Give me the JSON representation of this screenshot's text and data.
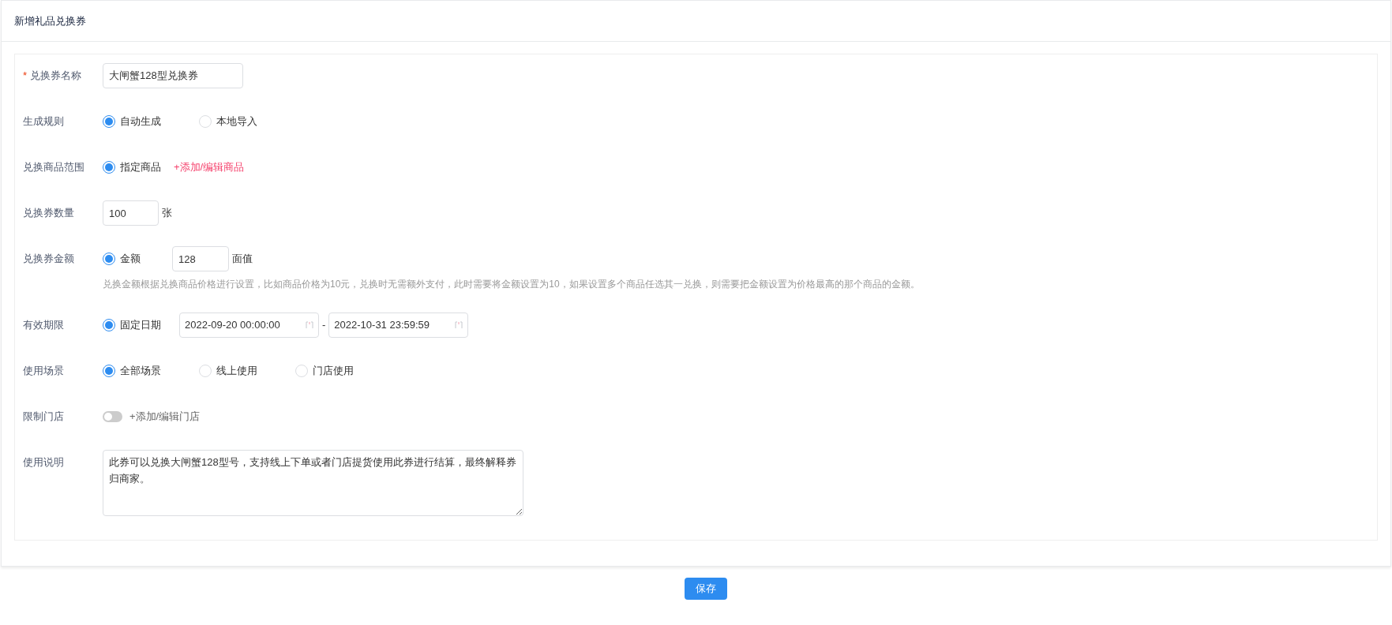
{
  "page_title": "新增礼品兑换券",
  "form": {
    "name": {
      "label": "兑换券名称",
      "required_mark": "*",
      "value": "大闸蟹128型兑换券"
    },
    "generation_rule": {
      "label": "生成规则",
      "options": [
        {
          "label": "自动生成",
          "selected": true
        },
        {
          "label": "本地导入",
          "selected": false
        }
      ]
    },
    "product_scope": {
      "label": "兑换商品范围",
      "options": [
        {
          "label": "指定商品",
          "selected": true
        }
      ],
      "link": "+添加/编辑商品"
    },
    "quantity": {
      "label": "兑换券数量",
      "value": "100",
      "unit": "张"
    },
    "amount": {
      "label": "兑换券金额",
      "options": [
        {
          "label": "金额",
          "selected": true
        }
      ],
      "value": "128",
      "unit": "面值",
      "hint": "兑换金额根据兑换商品价格进行设置，比如商品价格为10元，兑换时无需额外支付，此时需要将金额设置为10，如果设置多个商品任选其一兑换，则需要把金额设置为价格最高的那个商品的金额。"
    },
    "validity": {
      "label": "有效期限",
      "options": [
        {
          "label": "固定日期",
          "selected": true
        }
      ],
      "start": "2022-09-20 00:00:00",
      "separator": "-",
      "end": "2022-10-31 23:59:59"
    },
    "scene": {
      "label": "使用场景",
      "options": [
        {
          "label": "全部场景",
          "selected": true
        },
        {
          "label": "线上使用",
          "selected": false
        },
        {
          "label": "门店使用",
          "selected": false
        }
      ]
    },
    "restrict_store": {
      "label": "限制门店",
      "on": false,
      "link": "+添加/编辑门店"
    },
    "description": {
      "label": "使用说明",
      "value": "此券可以兑换大闸蟹128型号，支持线上下单或者门店提货使用此券进行结算，最终解释券归商家。"
    }
  },
  "save_button": "保存"
}
